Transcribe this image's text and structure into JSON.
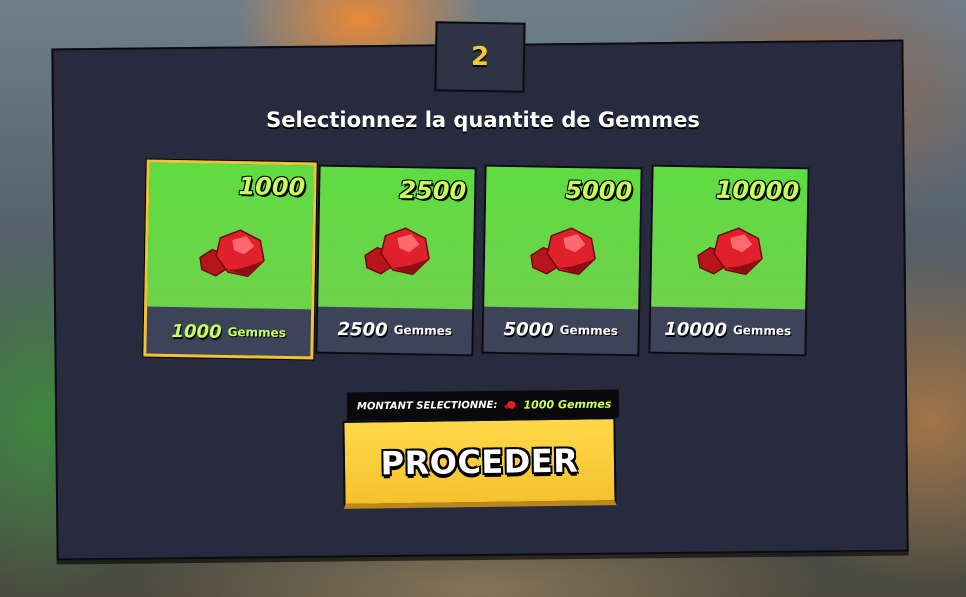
{
  "step": {
    "number": "2"
  },
  "title": "Selectionnez la quantite de Gemmes",
  "cards": [
    {
      "amount": "1000",
      "count": "1000",
      "unit": "Gemmes",
      "selected": true
    },
    {
      "amount": "2500",
      "count": "2500",
      "unit": "Gemmes",
      "selected": false
    },
    {
      "amount": "5000",
      "count": "5000",
      "unit": "Gemmes",
      "selected": false
    },
    {
      "amount": "10000",
      "count": "10000",
      "unit": "Gemmes",
      "selected": false
    }
  ],
  "summary": {
    "label": "MONTANT SELECTIONNE:",
    "value": "1000 Gemmes",
    "icon": "gem-icon"
  },
  "proceed_button": {
    "label": "PROCEDER"
  },
  "colors": {
    "panel": "#272b3d",
    "card_green": "#5fdc42",
    "accent_yellow": "#f2c233",
    "lime_text": "#c8ff5a",
    "gem_red": "#e0202a"
  }
}
